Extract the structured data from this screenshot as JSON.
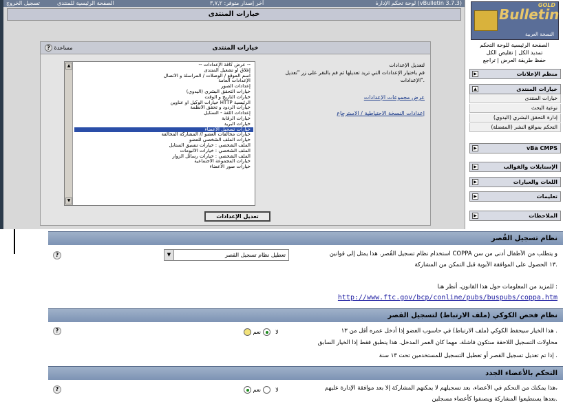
{
  "topbar": {
    "title": "لوحة تحكم الإدارة (vBulletin 3.7.3)",
    "version": "آخر إصدار متوفر: ٣,٧,٢",
    "home": "الصفحة الرئيسية للمنتدى",
    "logout": "تسجيل الخروج"
  },
  "page_title": "خيارات المنتدى",
  "panel": {
    "title": "خيارات المنتدى",
    "help": "مساعدة",
    "help_icon": "?",
    "options": [
      "-- عرض كافة الإعدادات --",
      "إغلاق أو تشغيل المنتدى",
      "اسم الموقع / الوصلات / المراسلة و الاتصال",
      "الإعدادات العامة",
      "إعدادات الصور",
      "خيارات التحقق البشري (اليدوي)",
      "خيارات التاريخ و الوقت",
      "خيارات الوكيل أو عناوين HTTP الرئيسية",
      "خيارات الردود و تحقق الأنظمة",
      "إعدادات اللغة - الستايل",
      "خيارات الرقابة",
      "خيارات البريد",
      "خيارات تسجيل الأعضاء",
      "خيارات مخالفات العضو // المشاركة المخالفة",
      "خيارات الملف الشخصي للعضو",
      "الملف الشخصي : خيارات تنسيق الستايل",
      "الملف الشخصي : خيارات الألبومات",
      "الملف الشخصي : خيارات رسائل الزوار",
      "خيارات المجموعة الاجتماعية",
      "خيارات صور الأعضاء"
    ],
    "selected_index": 12,
    "desc_heading": "لتعديل الإعدادات",
    "desc_text": "قم باختيار الإعدادات التي تريد تعديلها ثم قم بالنقر على زر \"تعديل الإعدادات\".",
    "link1": "عرض مجموعات الإعدادات",
    "link2": "إعدادات النسخة الاحتياطية / الاسترجاع",
    "button": "تعديل الإعدادات"
  },
  "sidebar": {
    "logo_text": "Bulletin",
    "logo_gold": "GOLD",
    "logo_sub": "النسخة العربية",
    "links": [
      "الصفحة الرئيسية للوحة التحكم",
      "تمديد الكل | تقليص الكل",
      "حفظ طريقة العرض | تراجع"
    ],
    "sections": [
      {
        "label": "منظم الإعلانات",
        "items": []
      },
      {
        "label": "خيارات المنتدى",
        "items": [
          "خيارات المنتدى",
          "نوعية البحث",
          "إدارة التحقق البشري (اليدوي)",
          "التحكم بمواقع النشر (المفضلة)"
        ]
      },
      {
        "label": "vBa CMPS",
        "items": []
      },
      {
        "label": "الإستايلات والقوالب",
        "items": []
      },
      {
        "label": "اللغات والعبارات",
        "items": []
      },
      {
        "label": "تعليمات",
        "items": []
      },
      {
        "label": "الملاحظات",
        "items": []
      }
    ]
  },
  "bottom": {
    "sec1_title": "نظام تسجيل القُصر",
    "sec1_text1": "استخدام نظام تسجيل القُصر. هذا يمثل إلى قوانين COPPA و يتطلب من الأطفال أدنى من سن",
    "sec1_text2": "١٣ الحصول على الموافقة الأبوية قبل التمكن من المشاركة.",
    "sec1_text3": "للمزيد من المعلومات حول هذا القانون، أنظر هنا :",
    "sec1_url": "http://www.ftc.gov/bcp/conline/pubs/buspubs/coppa.htm",
    "sec1_select": "تعطيل نظام تسجيل القصر",
    "sec2_title": "نظام فحص الكوكي (ملف الارتباط) لتسجيل القصر",
    "sec2_text1": "هذا الخيار سيحفظ الكوكي (ملف الارتباط) في حاسوب العضو إذا أدخل عمره أقل من ١٣ .",
    "sec2_text2": "محاولات التسجيل اللاحقة ستكون فاشلة، مهما كان العمر المدخل. هذا ينطبق فقط إذا الخيار السابق",
    "sec2_text3": "إذا تم تعديل تسجيل القصر أو تعطيل التسجيل للمستخدمين تحت ١٣ سنة .",
    "sec3_title": "التحكم بالأعضاء الجدد",
    "sec3_text1": "هذا يمكنك من التحكم في الأعضاء، بعد تسجيلهم لا يمكنهم المشاركة إلا بعد موافقة الإدارة عليهم،",
    "sec3_text2": "بعدها يستطيعوا المشاركة ويصنفوا كأعضاء مسجلين.",
    "yes": "نعم",
    "no": "لا",
    "help_icon": "?"
  }
}
